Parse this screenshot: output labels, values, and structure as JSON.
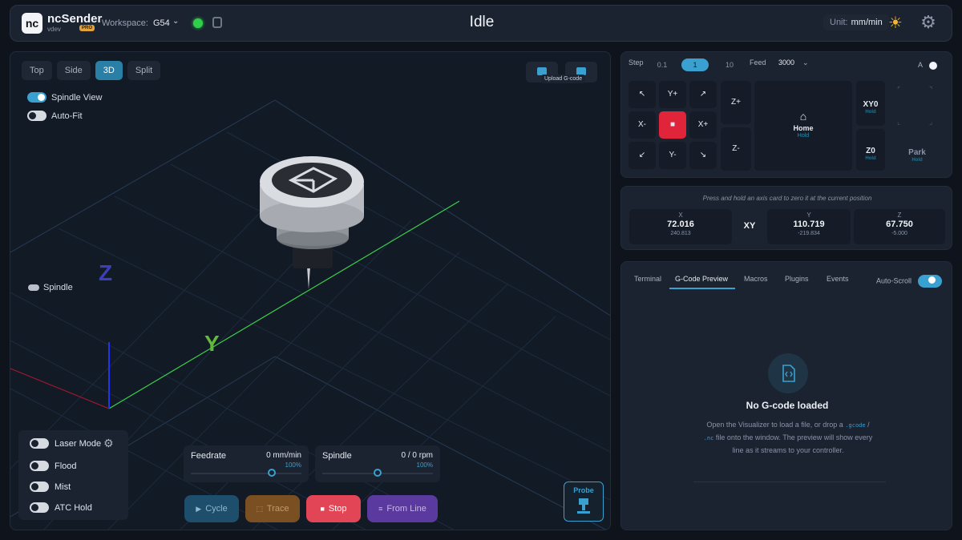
{
  "header": {
    "logo_text": "nc",
    "brand": "ncSender",
    "version": "vdev",
    "pro_badge": "PRO",
    "workspace_label": "Workspace:",
    "workspace_value": "G54",
    "state": "Idle",
    "unit_label": "Unit:",
    "unit_value": "mm/min",
    "connection_color": "#2fcf4a"
  },
  "viz": {
    "tabs": [
      "Top",
      "Side",
      "3D",
      "Split"
    ],
    "active_tab": "3D",
    "spindle_view_label": "Spindle View",
    "autofit_label": "Auto-Fit",
    "upload_tooltip": "Upload G-code",
    "axis_z": "Z",
    "axis_y": "Y",
    "spindle_label": "Spindle",
    "coolant": {
      "laser": "Laser Mode",
      "flood": "Flood",
      "mist": "Mist",
      "atc": "ATC Hold"
    },
    "feedrate": {
      "title": "Feedrate",
      "value": "0 mm/min",
      "pct": "100%",
      "level": 0.73
    },
    "spindle": {
      "title": "Spindle",
      "value": "0 / 0 rpm",
      "pct": "100%",
      "level": 0.5
    },
    "actions": {
      "cycle": "Cycle",
      "trace": "Trace",
      "stop": "Stop",
      "from_line": "From Line"
    },
    "probe": "Probe"
  },
  "jog": {
    "step_label": "Step",
    "steps": [
      "0.1",
      "1",
      "10"
    ],
    "active_step": "1",
    "feed_label": "Feed",
    "feed_value": "3000",
    "a_label": "A",
    "y_plus": "Y+",
    "y_minus": "Y-",
    "x_plus": "X+",
    "x_minus": "X-",
    "z_plus": "Z+",
    "z_minus": "Z-",
    "home_title": "Home",
    "home_sub": "Hold",
    "xy0": "XY0",
    "z0": "Z0",
    "park": "Park",
    "hold": "Hold"
  },
  "dro": {
    "hint": "Press and hold an axis card to zero it at the current position",
    "x": {
      "name": "X",
      "work": "72.016",
      "machine": "240.813"
    },
    "xy_label": "XY",
    "y": {
      "name": "Y",
      "work": "110.719",
      "machine": "-219.834"
    },
    "z": {
      "name": "Z",
      "work": "67.750",
      "machine": "-5.000"
    }
  },
  "console": {
    "tabs": [
      "Terminal",
      "G-Code Preview",
      "Macros",
      "Plugins",
      "Events"
    ],
    "active_tab": "G-Code Preview",
    "autoscroll_label": "Auto-Scroll",
    "empty_title": "No G-code loaded",
    "empty_desc_1": "Open the Visualizer to load a file, or drop a",
    "ext_gcode": ".gcode",
    "slash": "/",
    "ext_nc": ".nc",
    "empty_desc_2": "file onto the window. The preview will show every line as it streams to your controller."
  }
}
